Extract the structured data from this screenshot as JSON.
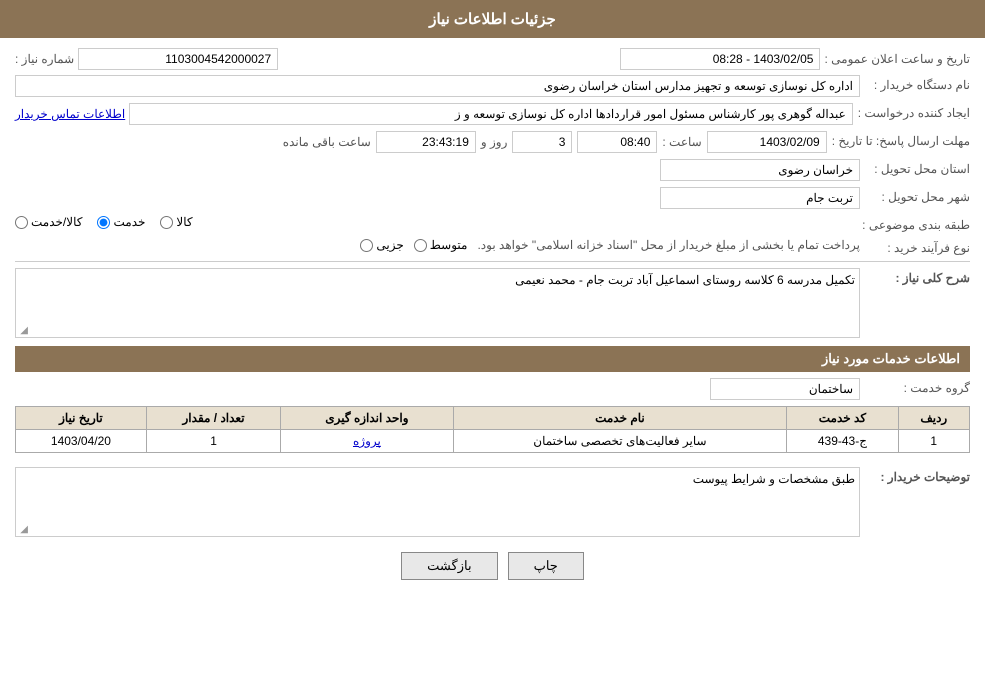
{
  "page": {
    "title": "جزئیات اطلاعات نیاز"
  },
  "header": {
    "title": "جزئیات اطلاعات نیاز"
  },
  "fields": {
    "need_number_label": "شماره نیاز :",
    "need_number_value": "1103004542000027",
    "buyer_org_label": "نام دستگاه خریدار :",
    "buyer_org_value": "اداره کل نوسازی  توسعه و تجهیز مدارس استان خراسان رضوی",
    "creator_label": "ایجاد کننده درخواست :",
    "creator_value": "عبداله گوهری پور کارشناس مسئول امور قراردادها  اداره کل نوسازی  توسعه و ز",
    "creator_link": "اطلاعات تماس خریدار",
    "response_deadline_label": "مهلت ارسال پاسخ: تا تاریخ :",
    "response_date": "1403/02/09",
    "response_time": "08:40",
    "response_days": "3",
    "response_remaining": "23:43:19",
    "response_date_label": "",
    "response_time_label": "ساعت :",
    "response_days_label": "روز و",
    "response_remaining_label": "ساعت باقی مانده",
    "province_label": "استان محل تحویل :",
    "province_value": "خراسان رضوی",
    "city_label": "شهر محل تحویل :",
    "city_value": "تربت جام",
    "category_label": "طبقه بندی موضوعی :",
    "category_options": [
      {
        "label": "کالا",
        "selected": false
      },
      {
        "label": "خدمت",
        "selected": true
      },
      {
        "label": "کالا/خدمت",
        "selected": false
      }
    ],
    "purchase_type_label": "نوع فرآیند خرید :",
    "purchase_types": [
      {
        "label": "جزیی",
        "selected": false
      },
      {
        "label": "متوسط",
        "selected": false
      }
    ],
    "purchase_note": "پرداخت تمام یا بخشی از مبلغ خریدار از محل \"اسناد خزانه اسلامی\" خواهد بود.",
    "need_description_label": "شرح کلی نیاز :",
    "need_description_value": "تکمیل مدرسه 6 کلاسه روستای اسماعیل آباد تربت جام - محمد نعیمی",
    "services_section_title": "اطلاعات خدمات مورد نیاز",
    "service_group_label": "گروه خدمت :",
    "service_group_value": "ساختمان",
    "table": {
      "headers": [
        "ردیف",
        "کد خدمت",
        "نام خدمت",
        "واحد اندازه گیری",
        "تعداد / مقدار",
        "تاریخ نیاز"
      ],
      "rows": [
        {
          "row": "1",
          "code": "ج-43-439",
          "name": "سایر فعالیت‌های تخصصی ساختمان",
          "unit": "پروژه",
          "quantity": "1",
          "date": "1403/04/20"
        }
      ]
    },
    "buyer_desc_label": "توضیحات خریدار :",
    "buyer_desc_value": "طبق مشخصات و شرایط پیوست"
  },
  "buttons": {
    "print": "چاپ",
    "back": "بازگشت"
  }
}
